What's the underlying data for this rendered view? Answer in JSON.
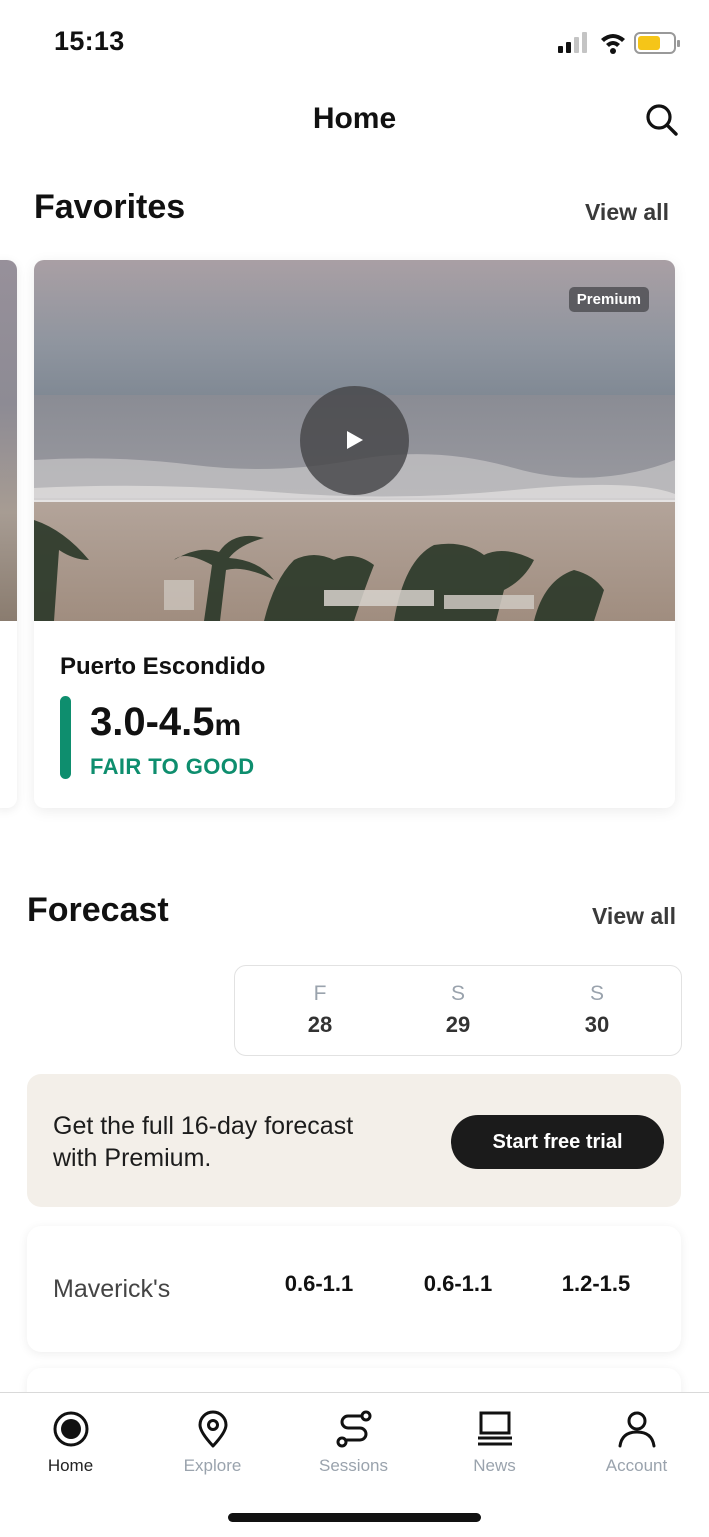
{
  "status": {
    "time": "15:13"
  },
  "header": {
    "title": "Home",
    "search_icon": "search-icon"
  },
  "favorites": {
    "title": "Favorites",
    "view_all": "View all",
    "card": {
      "badge": "Premium",
      "spot_name": "Puerto Escondido",
      "wave_height": "3.0-4.5",
      "unit": "m",
      "rating": "FAIR TO GOOD",
      "rating_color": "#0e8e6e"
    }
  },
  "forecast": {
    "title": "Forecast",
    "view_all": "View all",
    "days": [
      {
        "letter": "F",
        "date": "28"
      },
      {
        "letter": "S",
        "date": "29"
      },
      {
        "letter": "S",
        "date": "30"
      }
    ],
    "promo": {
      "text": "Get the full 16-day forecast with Premium.",
      "button": "Start free trial"
    },
    "spots": [
      {
        "name": "Maverick's",
        "values": [
          "0.6-1.1",
          "0.6-1.1",
          "1.2-1.5"
        ]
      }
    ]
  },
  "tabbar": {
    "tabs": [
      {
        "label": "Home",
        "icon": "home-icon",
        "active": true
      },
      {
        "label": "Explore",
        "icon": "map-pin-icon",
        "active": false
      },
      {
        "label": "Sessions",
        "icon": "sessions-route-icon",
        "active": false
      },
      {
        "label": "News",
        "icon": "news-icon",
        "active": false
      },
      {
        "label": "Account",
        "icon": "account-icon",
        "active": false
      }
    ]
  }
}
